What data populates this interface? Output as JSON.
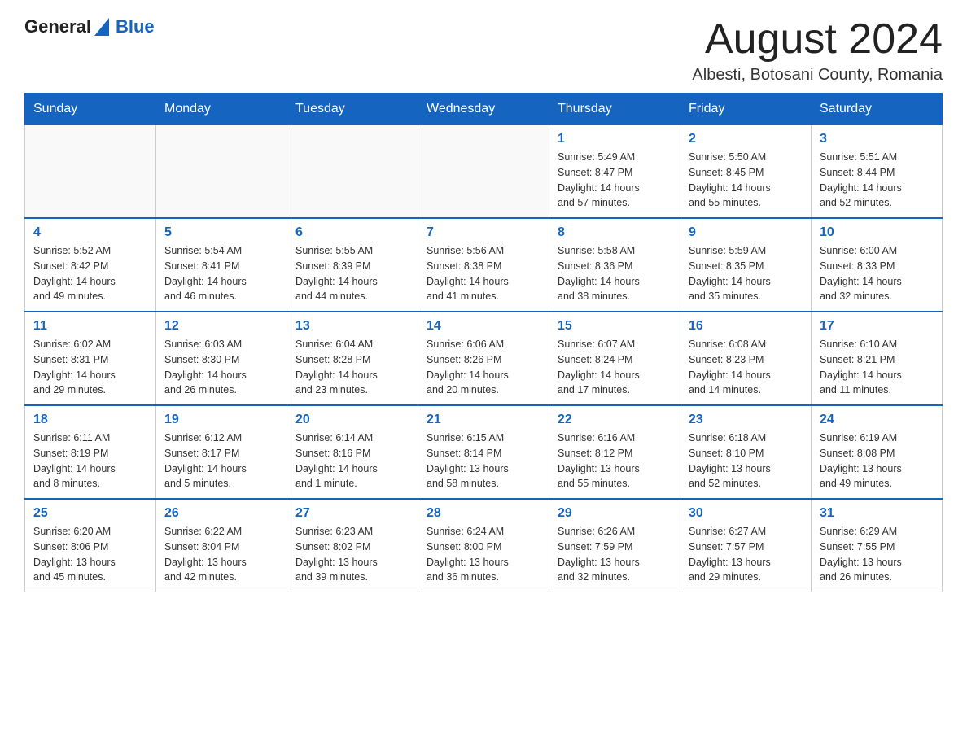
{
  "header": {
    "logo_general": "General",
    "logo_blue": "Blue",
    "month_title": "August 2024",
    "location": "Albesti, Botosani County, Romania"
  },
  "days_of_week": [
    "Sunday",
    "Monday",
    "Tuesday",
    "Wednesday",
    "Thursday",
    "Friday",
    "Saturday"
  ],
  "weeks": [
    [
      {
        "day": "",
        "info": ""
      },
      {
        "day": "",
        "info": ""
      },
      {
        "day": "",
        "info": ""
      },
      {
        "day": "",
        "info": ""
      },
      {
        "day": "1",
        "info": "Sunrise: 5:49 AM\nSunset: 8:47 PM\nDaylight: 14 hours\nand 57 minutes."
      },
      {
        "day": "2",
        "info": "Sunrise: 5:50 AM\nSunset: 8:45 PM\nDaylight: 14 hours\nand 55 minutes."
      },
      {
        "day": "3",
        "info": "Sunrise: 5:51 AM\nSunset: 8:44 PM\nDaylight: 14 hours\nand 52 minutes."
      }
    ],
    [
      {
        "day": "4",
        "info": "Sunrise: 5:52 AM\nSunset: 8:42 PM\nDaylight: 14 hours\nand 49 minutes."
      },
      {
        "day": "5",
        "info": "Sunrise: 5:54 AM\nSunset: 8:41 PM\nDaylight: 14 hours\nand 46 minutes."
      },
      {
        "day": "6",
        "info": "Sunrise: 5:55 AM\nSunset: 8:39 PM\nDaylight: 14 hours\nand 44 minutes."
      },
      {
        "day": "7",
        "info": "Sunrise: 5:56 AM\nSunset: 8:38 PM\nDaylight: 14 hours\nand 41 minutes."
      },
      {
        "day": "8",
        "info": "Sunrise: 5:58 AM\nSunset: 8:36 PM\nDaylight: 14 hours\nand 38 minutes."
      },
      {
        "day": "9",
        "info": "Sunrise: 5:59 AM\nSunset: 8:35 PM\nDaylight: 14 hours\nand 35 minutes."
      },
      {
        "day": "10",
        "info": "Sunrise: 6:00 AM\nSunset: 8:33 PM\nDaylight: 14 hours\nand 32 minutes."
      }
    ],
    [
      {
        "day": "11",
        "info": "Sunrise: 6:02 AM\nSunset: 8:31 PM\nDaylight: 14 hours\nand 29 minutes."
      },
      {
        "day": "12",
        "info": "Sunrise: 6:03 AM\nSunset: 8:30 PM\nDaylight: 14 hours\nand 26 minutes."
      },
      {
        "day": "13",
        "info": "Sunrise: 6:04 AM\nSunset: 8:28 PM\nDaylight: 14 hours\nand 23 minutes."
      },
      {
        "day": "14",
        "info": "Sunrise: 6:06 AM\nSunset: 8:26 PM\nDaylight: 14 hours\nand 20 minutes."
      },
      {
        "day": "15",
        "info": "Sunrise: 6:07 AM\nSunset: 8:24 PM\nDaylight: 14 hours\nand 17 minutes."
      },
      {
        "day": "16",
        "info": "Sunrise: 6:08 AM\nSunset: 8:23 PM\nDaylight: 14 hours\nand 14 minutes."
      },
      {
        "day": "17",
        "info": "Sunrise: 6:10 AM\nSunset: 8:21 PM\nDaylight: 14 hours\nand 11 minutes."
      }
    ],
    [
      {
        "day": "18",
        "info": "Sunrise: 6:11 AM\nSunset: 8:19 PM\nDaylight: 14 hours\nand 8 minutes."
      },
      {
        "day": "19",
        "info": "Sunrise: 6:12 AM\nSunset: 8:17 PM\nDaylight: 14 hours\nand 5 minutes."
      },
      {
        "day": "20",
        "info": "Sunrise: 6:14 AM\nSunset: 8:16 PM\nDaylight: 14 hours\nand 1 minute."
      },
      {
        "day": "21",
        "info": "Sunrise: 6:15 AM\nSunset: 8:14 PM\nDaylight: 13 hours\nand 58 minutes."
      },
      {
        "day": "22",
        "info": "Sunrise: 6:16 AM\nSunset: 8:12 PM\nDaylight: 13 hours\nand 55 minutes."
      },
      {
        "day": "23",
        "info": "Sunrise: 6:18 AM\nSunset: 8:10 PM\nDaylight: 13 hours\nand 52 minutes."
      },
      {
        "day": "24",
        "info": "Sunrise: 6:19 AM\nSunset: 8:08 PM\nDaylight: 13 hours\nand 49 minutes."
      }
    ],
    [
      {
        "day": "25",
        "info": "Sunrise: 6:20 AM\nSunset: 8:06 PM\nDaylight: 13 hours\nand 45 minutes."
      },
      {
        "day": "26",
        "info": "Sunrise: 6:22 AM\nSunset: 8:04 PM\nDaylight: 13 hours\nand 42 minutes."
      },
      {
        "day": "27",
        "info": "Sunrise: 6:23 AM\nSunset: 8:02 PM\nDaylight: 13 hours\nand 39 minutes."
      },
      {
        "day": "28",
        "info": "Sunrise: 6:24 AM\nSunset: 8:00 PM\nDaylight: 13 hours\nand 36 minutes."
      },
      {
        "day": "29",
        "info": "Sunrise: 6:26 AM\nSunset: 7:59 PM\nDaylight: 13 hours\nand 32 minutes."
      },
      {
        "day": "30",
        "info": "Sunrise: 6:27 AM\nSunset: 7:57 PM\nDaylight: 13 hours\nand 29 minutes."
      },
      {
        "day": "31",
        "info": "Sunrise: 6:29 AM\nSunset: 7:55 PM\nDaylight: 13 hours\nand 26 minutes."
      }
    ]
  ]
}
